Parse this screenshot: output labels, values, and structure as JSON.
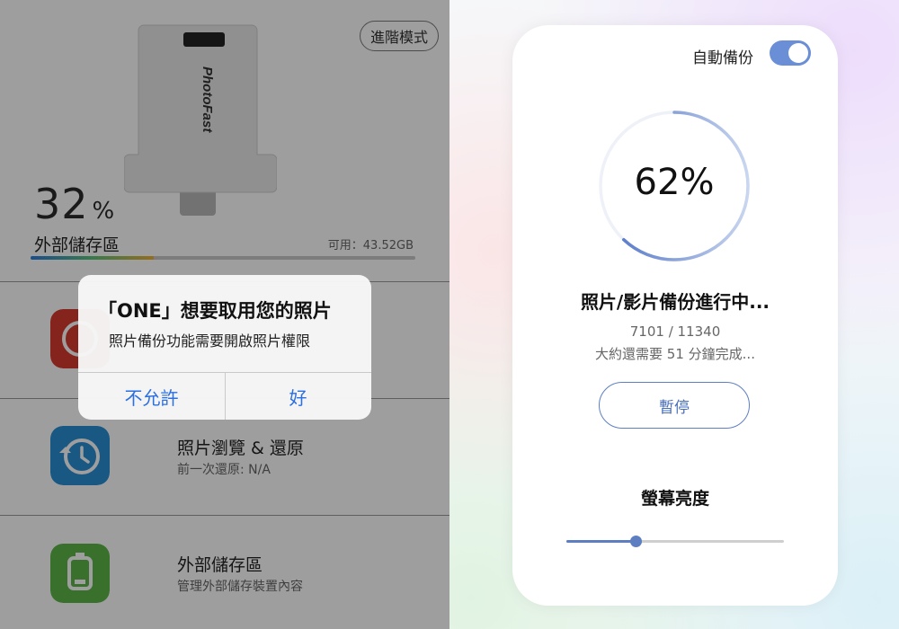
{
  "left": {
    "advanced_mode_label": "進階模式",
    "device_brand": "PhotoFast",
    "storage_percent": "32",
    "percent_sign": "%",
    "storage_title": "外部儲存區",
    "available_text": "可用：43.52GB",
    "storage_used_fraction": 0.32,
    "menu": [
      {
        "title": "照片瀏覽 & 還原",
        "subtitle": "前一次還原: N/A",
        "icon": "clock-restore-icon"
      },
      {
        "title": "外部儲存區",
        "subtitle": "管理外部儲存裝置內容",
        "icon": "storage-device-icon"
      }
    ],
    "alert": {
      "title": "「ONE」想要取用您的照片",
      "message": "照片備份功能需要開啟照片權限",
      "deny_label": "不允許",
      "ok_label": "好"
    }
  },
  "right": {
    "auto_backup_label": "自動備份",
    "auto_backup_on": true,
    "progress_percent_text": "62%",
    "progress_fraction": 0.62,
    "status_title": "照片/影片備份進行中...",
    "count_text": "7101 / 11340",
    "remaining_text": "大約還需要 51 分鐘完成...",
    "pause_label": "暫停",
    "brightness_label": "螢幕亮度",
    "brightness_fraction": 0.32
  },
  "colors": {
    "accent_blue": "#5d7fc2",
    "ios_button_blue": "#2b6fe0",
    "photo_icon_red": "#d63a2f",
    "restore_icon_blue": "#2a8fd6",
    "storage_icon_green": "#5bb547"
  }
}
